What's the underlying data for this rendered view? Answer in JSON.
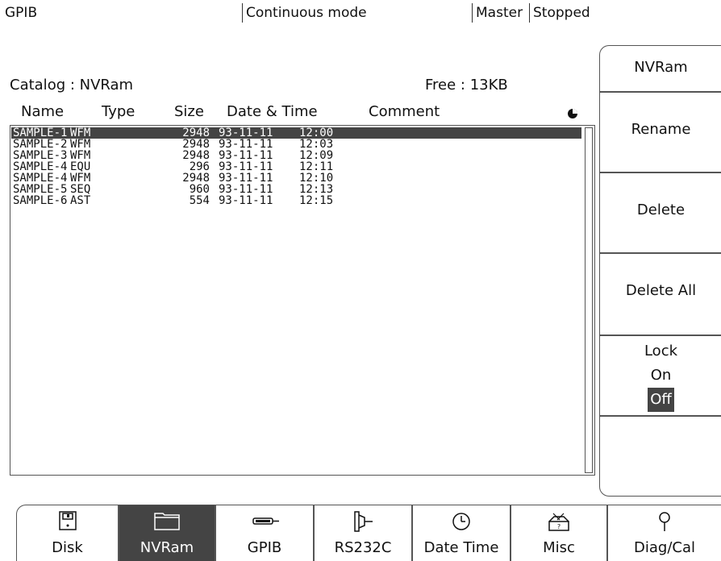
{
  "status_bar": {
    "interface": "GPIB",
    "mode": "Continuous mode",
    "role": "Master",
    "state": "Stopped"
  },
  "catalog": {
    "title": "Catalog : NVRam",
    "free": "Free : 13KB",
    "columns": [
      "Name",
      "Type",
      "Size",
      "Date & Time",
      "Comment"
    ],
    "files": [
      {
        "name": "SAMPLE-1",
        "type": "WFM",
        "size": "2948",
        "date": "93-11-11",
        "time": "12:00",
        "selected": true
      },
      {
        "name": "SAMPLE-2",
        "type": "WFM",
        "size": "2948",
        "date": "93-11-11",
        "time": "12:03"
      },
      {
        "name": "SAMPLE-3",
        "type": "WFM",
        "size": "2948",
        "date": "93-11-11",
        "time": "12:09"
      },
      {
        "name": "SAMPLE-4",
        "type": "EQU",
        "size": "296",
        "date": "93-11-11",
        "time": "12:11"
      },
      {
        "name": "SAMPLE-4",
        "type": "WFM",
        "size": "2948",
        "date": "93-11-11",
        "time": "12:10"
      },
      {
        "name": "SAMPLE-5",
        "type": "SEQ",
        "size": "960",
        "date": "93-11-11",
        "time": "12:13"
      },
      {
        "name": "SAMPLE-6",
        "type": "AST",
        "size": "554",
        "date": "93-11-11",
        "time": "12:15"
      }
    ]
  },
  "side_menu": {
    "title": "NVRam",
    "rename": "Rename",
    "delete": "Delete",
    "delete_all": "Delete All",
    "lock_label": "Lock",
    "lock_on": "On",
    "lock_off": "Off"
  },
  "tabs": [
    {
      "label": "Disk",
      "icon": "disk-icon"
    },
    {
      "label": "NVRam",
      "icon": "folder-icon",
      "active": true
    },
    {
      "label": "GPIB",
      "icon": "gpib-connector-icon"
    },
    {
      "label": "RS232C",
      "icon": "rs232c-connector-icon"
    },
    {
      "label": "Date Time",
      "icon": "clock-icon"
    },
    {
      "label": "Misc",
      "icon": "toolbox-icon"
    },
    {
      "label": "Diag/Cal",
      "icon": "probe-icon"
    }
  ]
}
